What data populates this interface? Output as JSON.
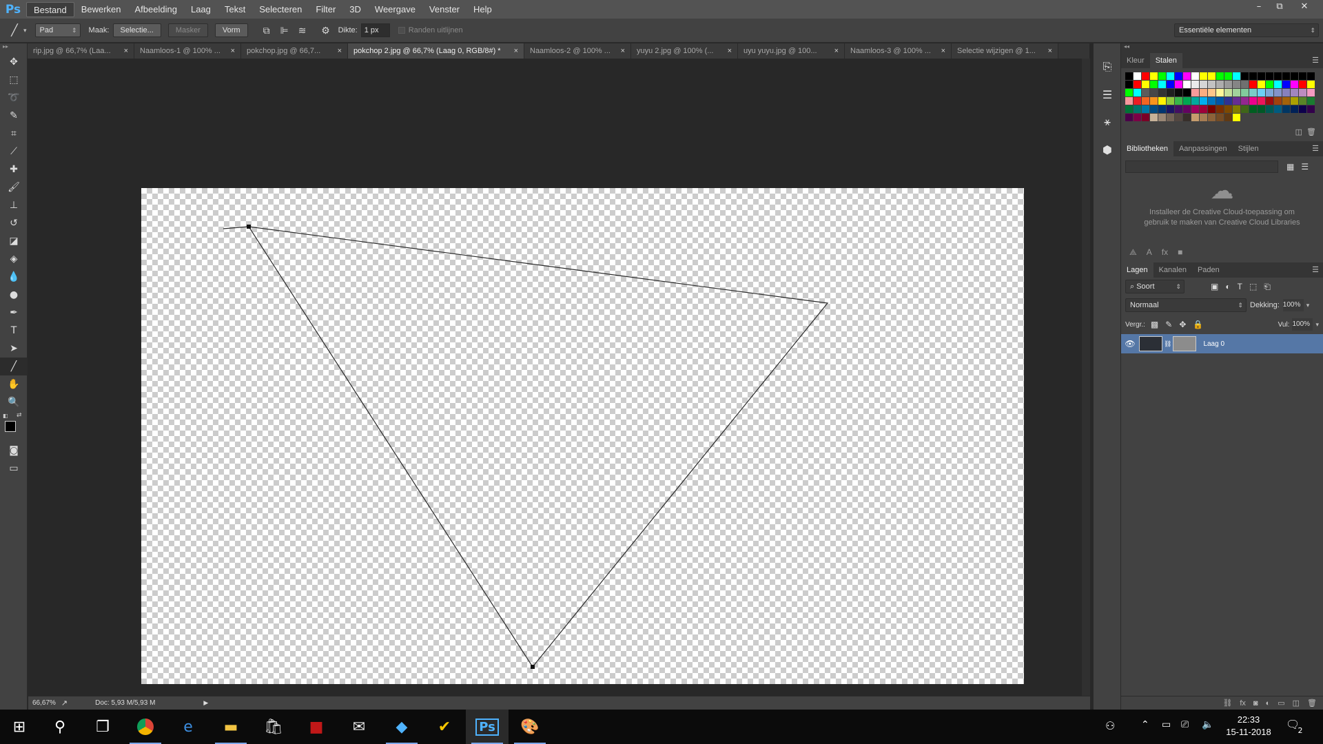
{
  "app": {
    "logo": "Ps"
  },
  "menu": [
    "Bestand",
    "Bewerken",
    "Afbeelding",
    "Laag",
    "Tekst",
    "Selecteren",
    "Filter",
    "3D",
    "Weergave",
    "Venster",
    "Help"
  ],
  "window_controls": [
    "–",
    "⧉",
    "✕"
  ],
  "options": {
    "mode": "Pad",
    "make_label": "Maak:",
    "selection_btn": "Selectie...",
    "mask_btn": "Masker",
    "shape_btn": "Vorm",
    "thickness_label": "Dikte:",
    "thickness_value": "1 px",
    "align_edges": "Randen uitlijnen",
    "workspace": "Essentiële elementen"
  },
  "tabs": [
    {
      "label": "rip.jpg @ 66,7% (Laa...",
      "active": false
    },
    {
      "label": "Naamloos-1 @ 100% ...",
      "active": false
    },
    {
      "label": "pokchop.jpg @ 66,7...",
      "active": false
    },
    {
      "label": "pokchop 2.jpg @ 66,7% (Laag 0, RGB/8#) *",
      "active": true
    },
    {
      "label": "Naamloos-2 @ 100% ...",
      "active": false
    },
    {
      "label": "yuyu 2.jpg @ 100% (...",
      "active": false
    },
    {
      "label": "uyu yuyu.jpg @ 100...",
      "active": false
    },
    {
      "label": "Naamloos-3 @ 100% ...",
      "active": false
    },
    {
      "label": "Selectie wijzigen @ 1...",
      "active": false
    }
  ],
  "tab_close": "×",
  "status": {
    "zoom": "66,67%",
    "doc": "Doc: 5,93 M/5,93 M"
  },
  "color_panel": {
    "tabs": [
      "Kleur",
      "Stalen"
    ],
    "active": "Stalen"
  },
  "swatch_colors": [
    "#000000",
    "#ffffff",
    "#ff0000",
    "#ffff00",
    "#00ff00",
    "#00ffff",
    "#0000ff",
    "#ff00ff",
    "#ffffff",
    "#ffff00",
    "#ffff00",
    "#00ff00",
    "#00ff00",
    "#00ffff",
    "#000000",
    "#000000",
    "#000000",
    "#000000",
    "#000000",
    "#000000",
    "#000000",
    "#000000",
    "#000000",
    "#000000",
    "#ff0000",
    "#ffff00",
    "#00ff00",
    "#00ffff",
    "#0000ff",
    "#ff00ff",
    "#ffffff",
    "#ebebeb",
    "#d6d6d6",
    "#c2c2c2",
    "#adadad",
    "#999999",
    "#858585",
    "#707070",
    "#ff0000",
    "#ffff00",
    "#00ff00",
    "#00ffff",
    "#0000ff",
    "#ff00ff",
    "#ff0000",
    "#ffff00",
    "#00ff00",
    "#00ffff",
    "#5c5c5c",
    "#474747",
    "#333333",
    "#1f1f1f",
    "#0a0a0a",
    "#000000",
    "#f79b9b",
    "#f9ad81",
    "#fdc68a",
    "#fff799",
    "#c4df9b",
    "#a2d39c",
    "#82ca9c",
    "#7accc8",
    "#6dcff6",
    "#7da7d9",
    "#8393ca",
    "#8781bd",
    "#a186be",
    "#bd8cbf",
    "#f49ac1",
    "#f6989d",
    "#ed1c24",
    "#f26522",
    "#f7941d",
    "#fff200",
    "#8dc73f",
    "#39b54a",
    "#00a651",
    "#00a99d",
    "#00aeef",
    "#0072bc",
    "#0054a6",
    "#2e3192",
    "#662d91",
    "#92278f",
    "#ec008c",
    "#ed145b",
    "#9e0b0f",
    "#a0410d",
    "#a3620a",
    "#aba000",
    "#598527",
    "#1a7b30",
    "#007236",
    "#00746b",
    "#0076a3",
    "#004b80",
    "#003471",
    "#1b1464",
    "#440e62",
    "#630460",
    "#9e005d",
    "#9e0039",
    "#790000",
    "#7b2e00",
    "#7d4900",
    "#827b00",
    "#406618",
    "#005e20",
    "#005826",
    "#005952",
    "#005b7f",
    "#003663",
    "#002157",
    "#0d004c",
    "#32004b",
    "#4b0049",
    "#7b0046",
    "#7a0026",
    "#c7b299",
    "#998675",
    "#736357",
    "#534741",
    "#372f2a",
    "#c69c6d",
    "#a67c52",
    "#8c6239",
    "#754c24",
    "#603913",
    "#ffff00"
  ],
  "libraries": {
    "tabs": [
      "Bibliotheken",
      "Aanpassingen",
      "Stijlen"
    ],
    "message": "Installeer de Creative Cloud-toepassing om gebruik te maken van Creative Cloud Libraries"
  },
  "layers": {
    "tabs": [
      "Lagen",
      "Kanalen",
      "Paden"
    ],
    "filter": "Soort",
    "blend_mode": "Normaal",
    "opacity_label": "Dekking:",
    "opacity_value": "100%",
    "lock_label": "Vergr.:",
    "fill_label": "Vul:",
    "fill_value": "100%",
    "items": [
      {
        "name": "Laag 0",
        "selected": true
      }
    ]
  },
  "taskbar": {
    "time": "22:33",
    "date": "15-11-2018",
    "notifications": "2"
  }
}
